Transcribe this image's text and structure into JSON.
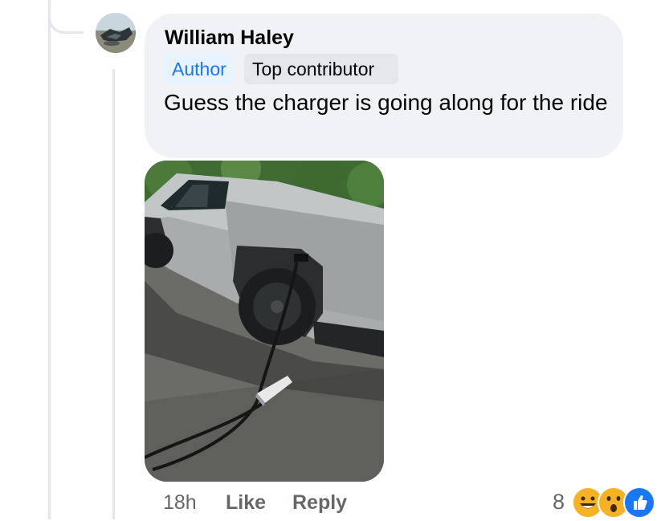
{
  "comment": {
    "author": "William Haley",
    "badges": {
      "author": "Author",
      "contributor": "Top contributor"
    },
    "text": "Guess the charger is going along for the ride",
    "photo_description_icon": "cybertruck-charging-photo",
    "timestamp": "18h",
    "like_label": "Like",
    "reply_label": "Reply",
    "reaction_count": "8",
    "reactions": [
      "haha-icon",
      "wow-icon",
      "like-icon"
    ]
  },
  "colors": {
    "bubble": "#f0f2f5",
    "author_badge_bg": "#e7f3ff",
    "author_badge_text": "#1877f2",
    "contributor_badge_bg": "#e4e6eb",
    "meta_text": "#65676b",
    "like_blue": "#1877f2",
    "emoji_yellow": "#f7b125"
  }
}
